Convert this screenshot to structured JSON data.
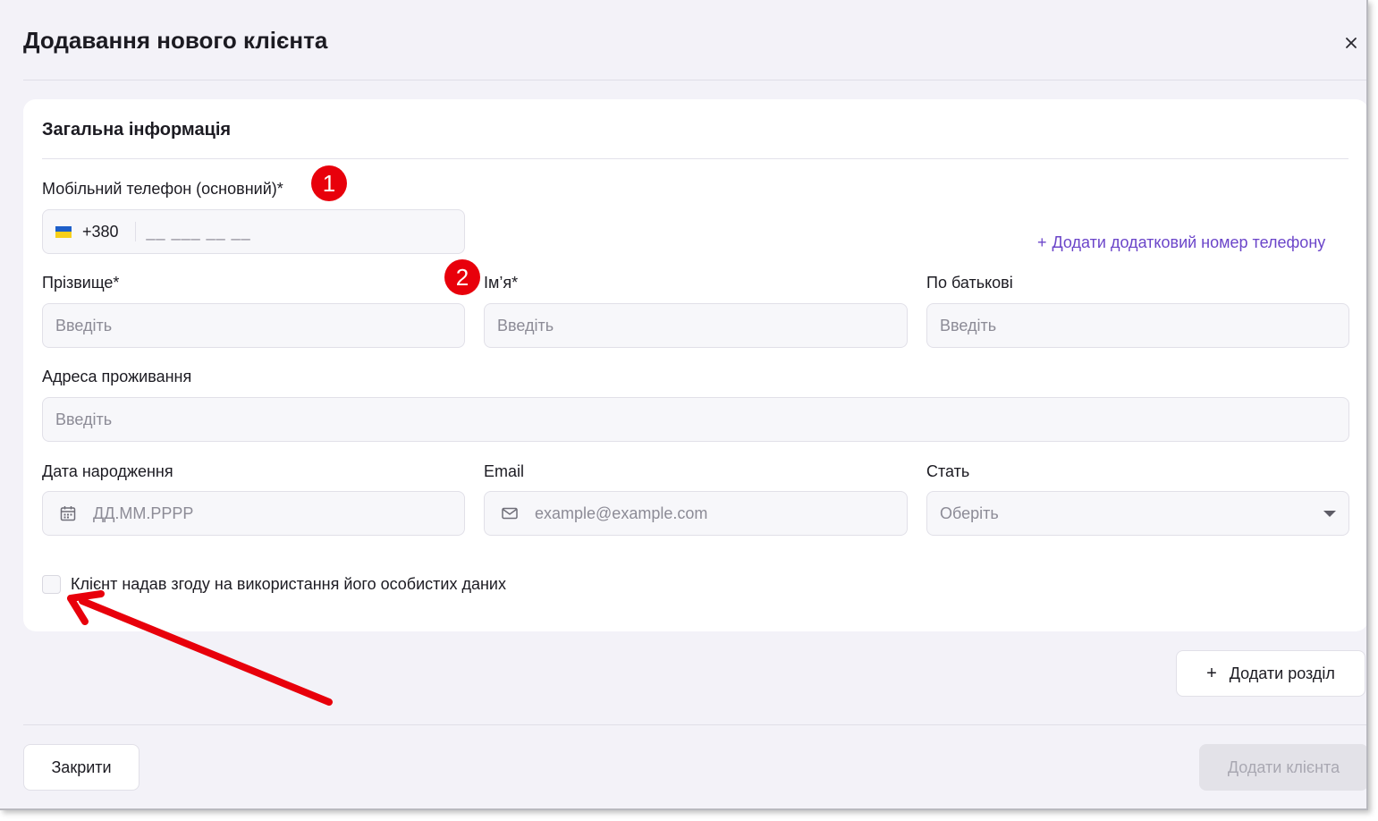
{
  "modal": {
    "title": "Додавання нового клієнта",
    "close_icon": "close-icon"
  },
  "general": {
    "section_title": "Загальна інформація",
    "phone": {
      "label": "Мобільний телефон (основний)*",
      "country_code": "+380",
      "mask": "__ ___ __ __",
      "flag_icon": "ukraine-flag-icon"
    },
    "add_phone_label": "Додати додатковий номер телефону",
    "surname": {
      "label": "Прізвище*",
      "placeholder": "Введіть"
    },
    "name": {
      "label": "Ім’я*",
      "placeholder": "Введіть"
    },
    "patronymic": {
      "label": "По батькові",
      "placeholder": "Введіть"
    },
    "address": {
      "label": "Адреса проживання",
      "placeholder": "Введіть"
    },
    "birthdate": {
      "label": "Дата народження",
      "placeholder": "ДД.ММ.РРРР",
      "icon": "calendar-icon"
    },
    "email": {
      "label": "Email",
      "placeholder": "example@example.com",
      "icon": "envelope-icon"
    },
    "gender": {
      "label": "Стать",
      "placeholder": "Оберіть",
      "icon": "chevron-down-icon"
    },
    "consent_label": "Клієнт надав згоду на використання його особистих даних"
  },
  "actions": {
    "add_section": "Додати розділ",
    "close": "Закрити",
    "add_client": "Додати клієнта"
  },
  "annotations": {
    "badge1": "1",
    "badge2": "2",
    "badge_color": "#e8000b",
    "arrow_color": "#e8000b"
  },
  "colors": {
    "background": "#f3f2f8",
    "accent": "#6b45c9",
    "disabled_button": "#e3e2e8"
  }
}
